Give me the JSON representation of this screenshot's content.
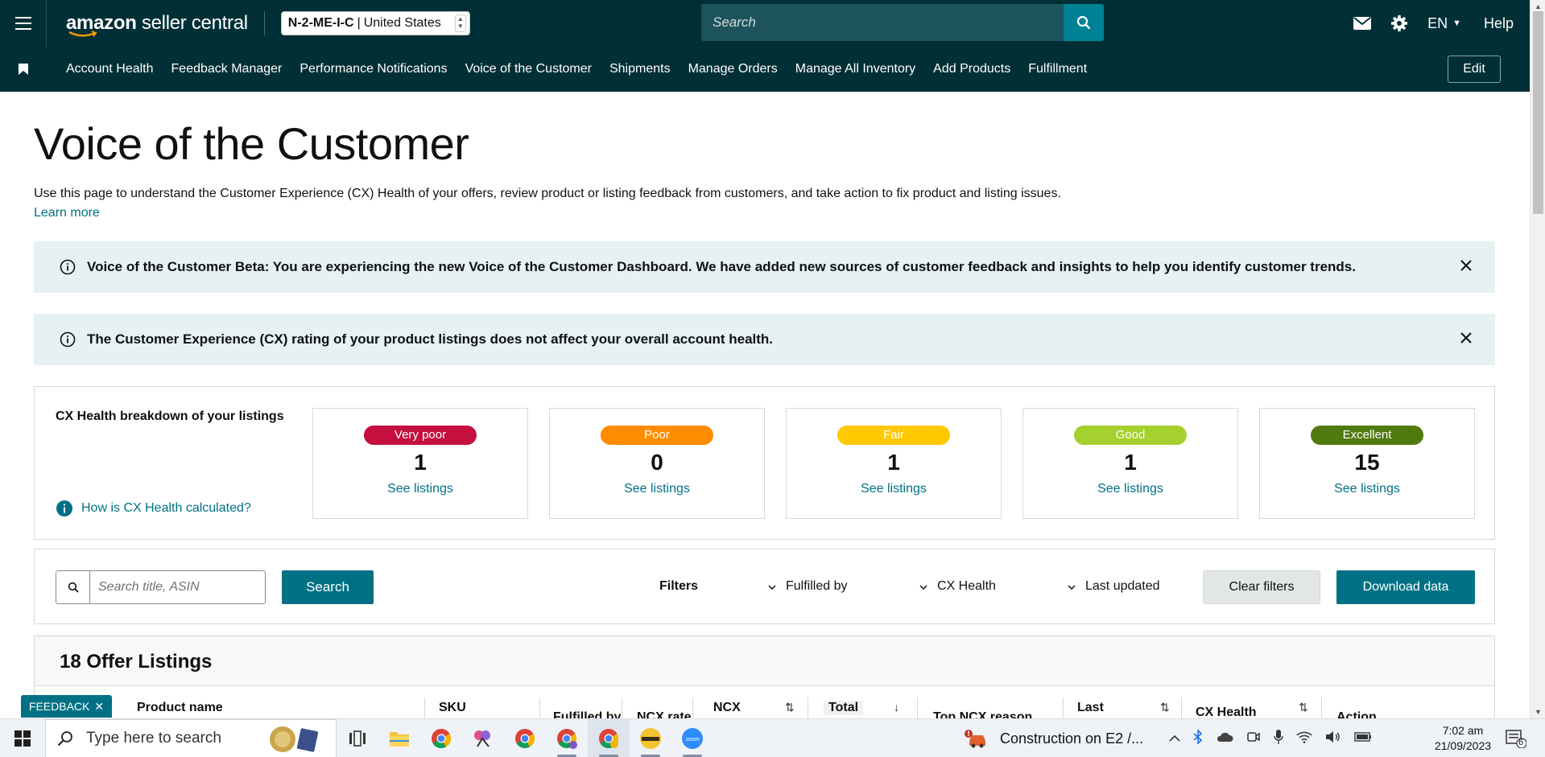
{
  "header": {
    "logo_brand": "amazon",
    "logo_product": "seller central",
    "account_name": "N-2-ME-I-C",
    "account_separator": "|",
    "marketplace": "United States",
    "search_placeholder": "Search",
    "language": "EN",
    "help_label": "Help"
  },
  "nav": {
    "items": [
      "Account Health",
      "Feedback Manager",
      "Performance Notifications",
      "Voice of the Customer",
      "Shipments",
      "Manage Orders",
      "Manage All Inventory",
      "Add Products",
      "Fulfillment"
    ],
    "edit_label": "Edit"
  },
  "page": {
    "title": "Voice of the Customer",
    "intro": "Use this page to understand the Customer Experience (CX) Health of your offers, review product or listing feedback from customers, and take action to fix product and listing issues.",
    "learn_more": "Learn more"
  },
  "alerts": [
    "Voice of the Customer Beta: You are experiencing the new Voice of the Customer Dashboard. We have added new sources of customer feedback and insights to help you identify customer trends.",
    "The Customer Experience (CX) rating of your product listings does not affect your overall account health."
  ],
  "cx_health": {
    "title": "CX Health breakdown of your listings",
    "how_link": "How is CX Health calculated?",
    "cards": [
      {
        "label": "Very poor",
        "count": "1",
        "link": "See listings",
        "color": "#c40f3f",
        "text_color": "#ffffff"
      },
      {
        "label": "Poor",
        "count": "0",
        "link": "See listings",
        "color": "#ff8c00",
        "text_color": "#ffffff"
      },
      {
        "label": "Fair",
        "count": "1",
        "link": "See listings",
        "color": "#ffc800",
        "text_color": "#ffffff"
      },
      {
        "label": "Good",
        "count": "1",
        "link": "See listings",
        "color": "#a5d02d",
        "text_color": "#ffffff"
      },
      {
        "label": "Excellent",
        "count": "15",
        "link": "See listings",
        "color": "#4f7a0e",
        "text_color": "#ffffff"
      }
    ]
  },
  "filters": {
    "search_placeholder": "Search title, ASIN",
    "search_button": "Search",
    "filters_label": "Filters",
    "fulfilled_by": "Fulfilled by",
    "cx_health": "CX Health",
    "last_updated": "Last updated",
    "clear_button": "Clear filters",
    "download_button": "Download data"
  },
  "listings": {
    "title": "18 Offer Listings",
    "columns": [
      "Product name",
      "SKU",
      "Fulfilled by",
      "NCX rate",
      "NCX",
      "Total",
      "Top NCX reason",
      "Last",
      "CX Health",
      "Action"
    ]
  },
  "feedback_tab": "FEEDBACK",
  "taskbar": {
    "search_placeholder": "Type here to search",
    "notice": "Construction on E2 /...",
    "time": "7:02 am",
    "date": "21/09/2023",
    "notification_count": "6"
  },
  "colors": {
    "header_bg": "#002f36",
    "accent": "#007185",
    "alert_bg": "#e5f1f2"
  }
}
